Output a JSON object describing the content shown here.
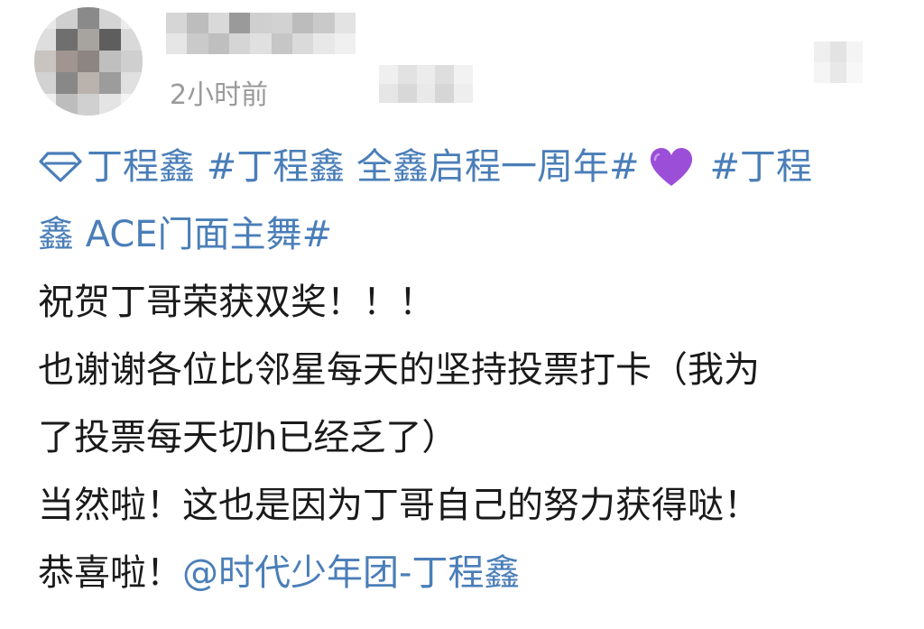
{
  "post": {
    "time": "2小时前",
    "lines": {
      "l1": {
        "super_topic": "丁程鑫",
        "hashtag1": "#丁程鑫 全鑫启程一周年#",
        "hashtag2_part": "#丁程"
      },
      "l2": {
        "hashtag2_rest": "鑫 ACE门面主舞#"
      },
      "l3": "祝贺丁哥荣获双奖！！！",
      "l4": "也谢谢各位比邻星每天的坚持投票打卡（我为",
      "l5": "了投票每天切h已经乏了）",
      "l6": "当然啦！这也是因为丁哥自己的努力获得哒！",
      "l7": {
        "text": "恭喜啦！",
        "mention": "@时代少年团-丁程鑫"
      }
    },
    "icons": {
      "super_topic": "diamond-icon",
      "emoji": "purple-heart-icon"
    },
    "colors": {
      "link": "#4a7eb8",
      "text": "#1a1a1a",
      "time": "#9a9a9a",
      "heart": "#9b4fd8"
    }
  }
}
